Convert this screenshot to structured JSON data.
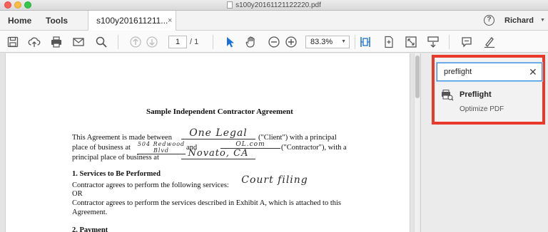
{
  "window": {
    "title": "s100y20161121122220.pdf"
  },
  "tabs": {
    "home": "Home",
    "tools": "Tools",
    "document": "s100y201611211...",
    "document_close": "×"
  },
  "user": {
    "help": "?",
    "name": "Richard"
  },
  "toolbar": {
    "icons": [
      "save-icon",
      "upload-icon",
      "print-icon",
      "email-icon",
      "search-icon",
      "page-up-icon",
      "page-down-icon",
      "select-pointer-icon",
      "hand-icon",
      "zoom-out-icon",
      "zoom-in-icon",
      "fit-page-icon",
      "full-screen-icon",
      "expand-icon",
      "scroll-mode-icon",
      "comment-icon",
      "sign-icon"
    ],
    "page_current": "1",
    "page_total": "/ 1",
    "zoom": "83.3%"
  },
  "document": {
    "title": "Sample Independent Contractor Agreement",
    "line1_a": "This Agreement is made between",
    "line1_hand": "One Legal",
    "line1_b": "(\"Client\") with a principal",
    "line2_a": "place of business at",
    "line2_hand1": "504 Redwood Blvd",
    "line2_and": "and",
    "line2_hand2": "OL.com",
    "line2_b": "(\"Contractor\"), with a",
    "line3_a": "principal place of business at",
    "line3_hand": "Novato, CA",
    "section1": "1. Services to Be Performed",
    "s1_line1": "Contractor agrees to perform the following services:",
    "s1_hand": "Court filing",
    "s1_or": "OR",
    "s1_line2": "Contractor agrees to perform the services described in Exhibit A, which is attached to this",
    "s1_line3": "Agreement.",
    "section2": "2. Payment"
  },
  "tools_panel": {
    "search_value": "preflight",
    "clear": "✕",
    "result_label": "Preflight",
    "result_sub": "Optimize PDF",
    "highlight_color": "#e8392a"
  }
}
